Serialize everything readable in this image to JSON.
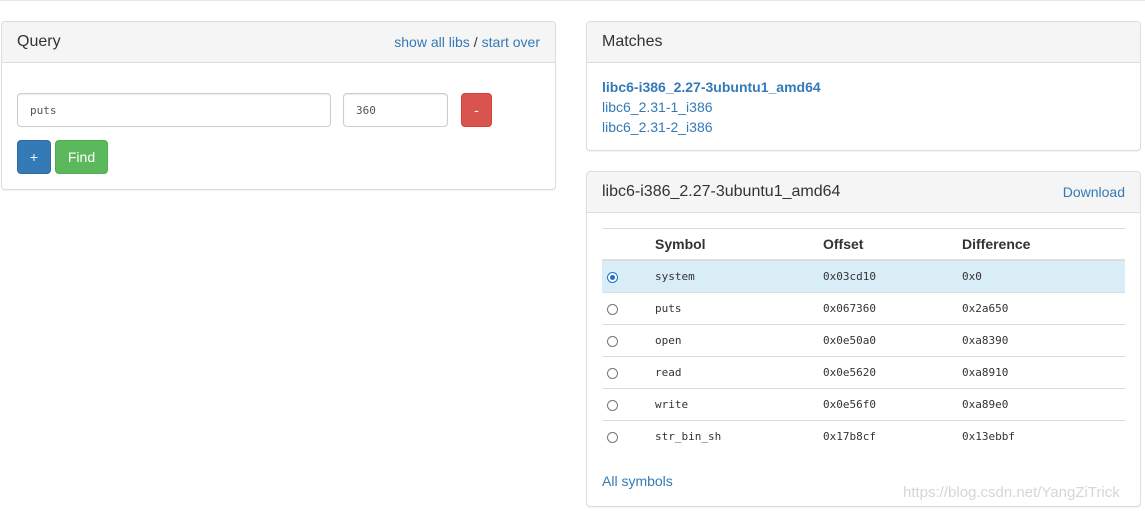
{
  "query": {
    "title": "Query",
    "show_all_libs": "show all libs",
    "separator": "/",
    "start_over": "start over",
    "symbol_value": "puts",
    "address_value": "360",
    "remove_label": "-",
    "add_label": "+",
    "find_label": "Find"
  },
  "matches": {
    "title": "Matches",
    "items": [
      {
        "label": "libc6-i386_2.27-3ubuntu1_amd64"
      },
      {
        "label": "libc6_2.31-1_i386"
      },
      {
        "label": "libc6_2.31-2_i386"
      }
    ]
  },
  "symbols": {
    "title": "libc6-i386_2.27-3ubuntu1_amd64",
    "download": "Download",
    "headers": {
      "symbol": "Symbol",
      "offset": "Offset",
      "difference": "Difference"
    },
    "rows": [
      {
        "symbol": "system",
        "offset": "0x03cd10",
        "difference": "0x0"
      },
      {
        "symbol": "puts",
        "offset": "0x067360",
        "difference": "0x2a650"
      },
      {
        "symbol": "open",
        "offset": "0x0e50a0",
        "difference": "0xa8390"
      },
      {
        "symbol": "read",
        "offset": "0x0e5620",
        "difference": "0xa8910"
      },
      {
        "symbol": "write",
        "offset": "0x0e56f0",
        "difference": "0xa89e0"
      },
      {
        "symbol": "str_bin_sh",
        "offset": "0x17b8cf",
        "difference": "0x13ebbf"
      }
    ],
    "selected_row": 0,
    "all_symbols": "All symbols"
  },
  "watermark": "https://blog.csdn.net/YangZiTrick",
  "colors": {
    "link": "#337ab7",
    "danger": "#d9534f",
    "primary": "#337ab7",
    "success": "#5cb85c",
    "selected_row": "#d9edf7"
  }
}
